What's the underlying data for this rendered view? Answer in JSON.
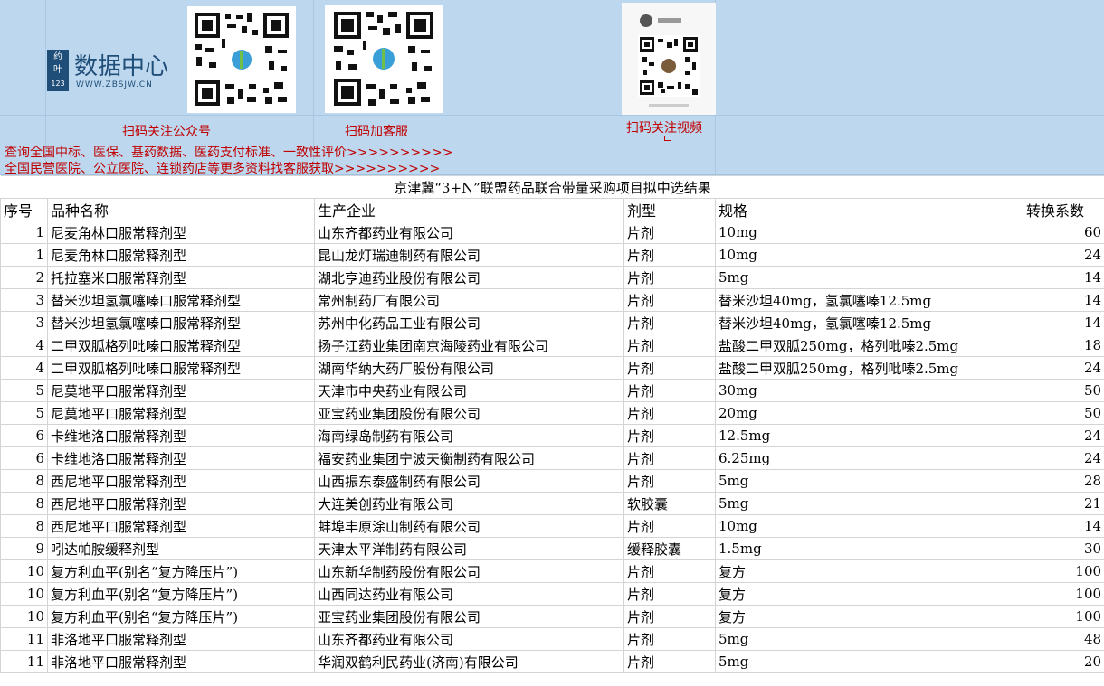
{
  "banner": {
    "logo": {
      "box_text": [
        "药",
        "叶",
        "123"
      ],
      "title": "数据中心",
      "url": "WWW.ZBSJW.CN",
      "registered_mark": "®"
    },
    "captions": {
      "qr1": "扫码关注公众号",
      "qr2": "扫码加客服",
      "qr3": "扫码关注视频"
    },
    "promo_lines": [
      "查询全国中标、医保、基药数据、医药支付标准、一致性评价>>>>>>>>>>",
      "全国民营医院、公立医院、连锁药店等更多资料找客服获取>>>>>>>>>>"
    ],
    "colors": {
      "background": "#bdd7ee",
      "caption": "#c00000",
      "brand": "#1f4e79"
    }
  },
  "sheet": {
    "title": "京津冀“3+N”联盟药品联合带量采购项目拟中选结果",
    "headers": [
      "序号",
      "品种名称",
      "生产企业",
      "剂型",
      "规格",
      "转换系数"
    ],
    "rows": [
      [
        "1",
        "尼麦角林口服常释剂型",
        "山东齐都药业有限公司",
        "片剂",
        "10mg",
        "60"
      ],
      [
        "1",
        "尼麦角林口服常释剂型",
        "昆山龙灯瑞迪制药有限公司",
        "片剂",
        "10mg",
        "24"
      ],
      [
        "2",
        "托拉塞米口服常释剂型",
        "湖北亨迪药业股份有限公司",
        "片剂",
        "5mg",
        "14"
      ],
      [
        "3",
        "替米沙坦氢氯噻嗪口服常释剂型",
        "常州制药厂有限公司",
        "片剂",
        "替米沙坦40mg，氢氯噻嗪12.5mg",
        "14"
      ],
      [
        "3",
        "替米沙坦氢氯噻嗪口服常释剂型",
        "苏州中化药品工业有限公司",
        "片剂",
        "替米沙坦40mg，氢氯噻嗪12.5mg",
        "14"
      ],
      [
        "4",
        "二甲双胍格列吡嗪口服常释剂型",
        "扬子江药业集团南京海陵药业有限公司",
        "片剂",
        "盐酸二甲双胍250mg，格列吡嗪2.5mg",
        "18"
      ],
      [
        "4",
        "二甲双胍格列吡嗪口服常释剂型",
        "湖南华纳大药厂股份有限公司",
        "片剂",
        "盐酸二甲双胍250mg，格列吡嗪2.5mg",
        "24"
      ],
      [
        "5",
        "尼莫地平口服常释剂型",
        "天津市中央药业有限公司",
        "片剂",
        "30mg",
        "50"
      ],
      [
        "5",
        "尼莫地平口服常释剂型",
        "亚宝药业集团股份有限公司",
        "片剂",
        "20mg",
        "50"
      ],
      [
        "6",
        "卡维地洛口服常释剂型",
        "海南绿岛制药有限公司",
        "片剂",
        "12.5mg",
        "24"
      ],
      [
        "6",
        "卡维地洛口服常释剂型",
        "福安药业集团宁波天衡制药有限公司",
        "片剂",
        "6.25mg",
        "24"
      ],
      [
        "8",
        "西尼地平口服常释剂型",
        "山西振东泰盛制药有限公司",
        "片剂",
        "5mg",
        "28"
      ],
      [
        "8",
        "西尼地平口服常释剂型",
        "大连美创药业有限公司",
        "软胶囊",
        "5mg",
        "21"
      ],
      [
        "8",
        "西尼地平口服常释剂型",
        "蚌埠丰原涂山制药有限公司",
        "片剂",
        "10mg",
        "14"
      ],
      [
        "9",
        "吲达帕胺缓释剂型",
        "天津太平洋制药有限公司",
        "缓释胶囊",
        "1.5mg",
        "30"
      ],
      [
        "10",
        "复方利血平(别名“复方降压片”)",
        "山东新华制药股份有限公司",
        "片剂",
        "复方",
        "100"
      ],
      [
        "10",
        "复方利血平(别名“复方降压片”)",
        "山西同达药业有限公司",
        "片剂",
        "复方",
        "100"
      ],
      [
        "10",
        "复方利血平(别名“复方降压片”)",
        "亚宝药业集团股份有限公司",
        "片剂",
        "复方",
        "100"
      ],
      [
        "11",
        "非洛地平口服常释剂型",
        "山东齐都药业有限公司",
        "片剂",
        "5mg",
        "48"
      ],
      [
        "11",
        "非洛地平口服常释剂型",
        "华润双鹤利民药业(济南)有限公司",
        "片剂",
        "5mg",
        "20"
      ]
    ]
  }
}
